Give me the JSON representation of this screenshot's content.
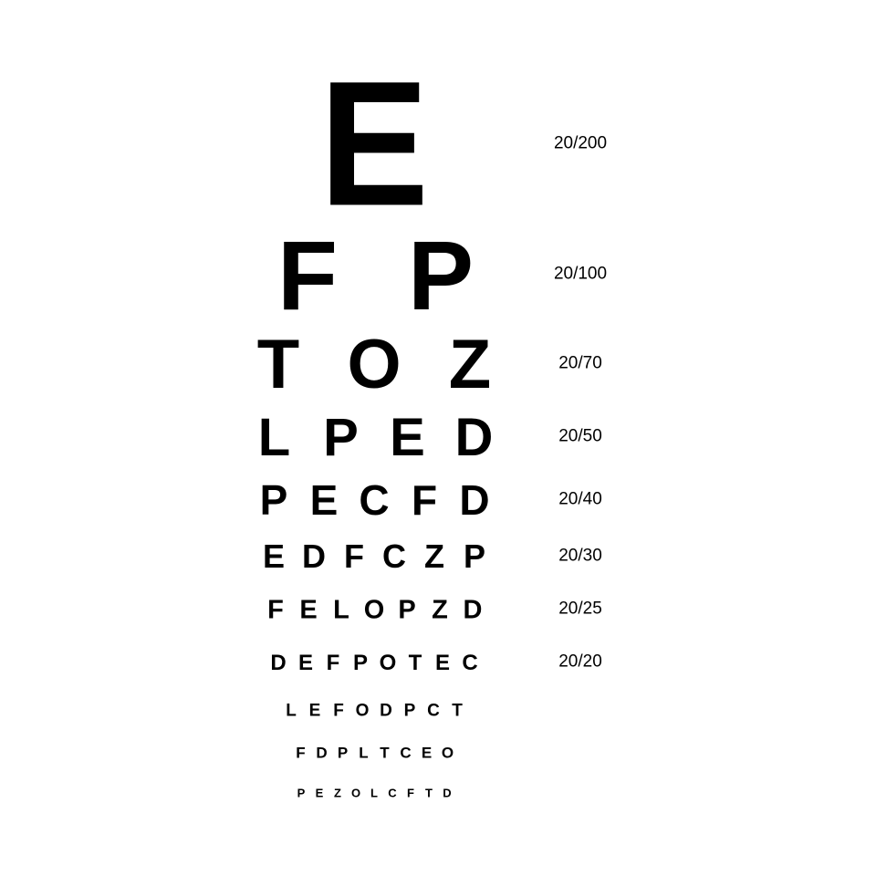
{
  "rows": [
    {
      "letters": [
        "E"
      ],
      "acuity": "20/200"
    },
    {
      "letters": [
        "F",
        "P"
      ],
      "acuity": "20/100"
    },
    {
      "letters": [
        "T",
        "O",
        "Z"
      ],
      "acuity": "20/70"
    },
    {
      "letters": [
        "L",
        "P",
        "E",
        "D"
      ],
      "acuity": "20/50"
    },
    {
      "letters": [
        "P",
        "E",
        "C",
        "F",
        "D"
      ],
      "acuity": "20/40"
    },
    {
      "letters": [
        "E",
        "D",
        "F",
        "C",
        "Z",
        "P"
      ],
      "acuity": "20/30"
    },
    {
      "letters": [
        "F",
        "E",
        "L",
        "O",
        "P",
        "Z",
        "D"
      ],
      "acuity": "20/25"
    },
    {
      "letters": [
        "D",
        "E",
        "F",
        "P",
        "O",
        "T",
        "E",
        "C"
      ],
      "acuity": "20/20"
    },
    {
      "letters": [
        "L",
        "E",
        "F",
        "O",
        "D",
        "P",
        "C",
        "T"
      ],
      "acuity": ""
    },
    {
      "letters": [
        "F",
        "D",
        "P",
        "L",
        "T",
        "C",
        "E",
        "O"
      ],
      "acuity": ""
    },
    {
      "letters": [
        "P",
        "E",
        "Z",
        "O",
        "L",
        "C",
        "F",
        "T",
        "D"
      ],
      "acuity": ""
    }
  ]
}
